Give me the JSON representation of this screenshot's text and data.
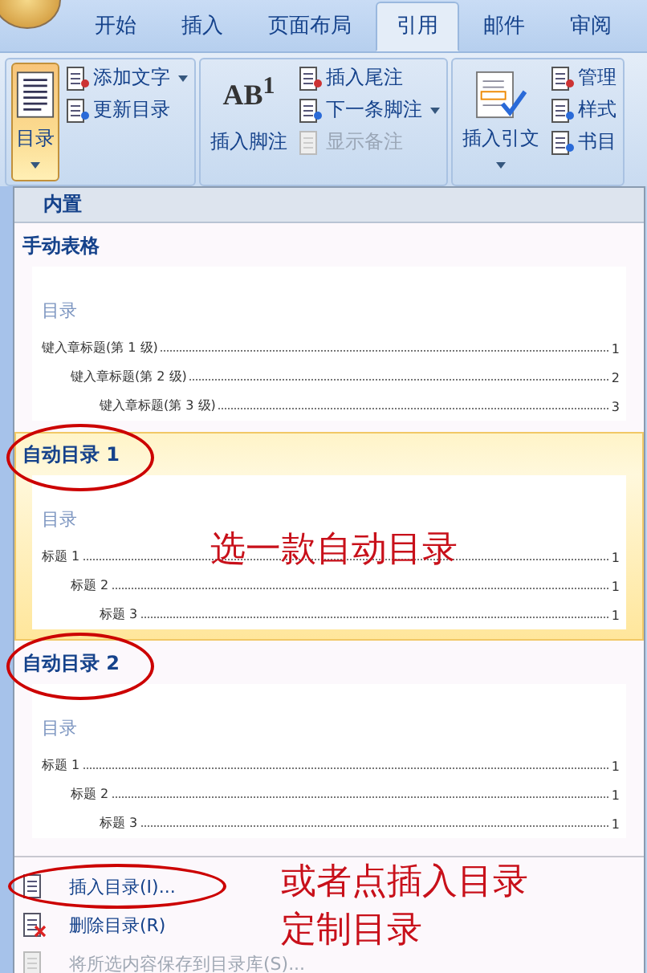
{
  "tabs": [
    {
      "label": "开始",
      "selected": false
    },
    {
      "label": "插入",
      "selected": false
    },
    {
      "label": "页面布局",
      "selected": false
    },
    {
      "label": "引用",
      "selected": true
    },
    {
      "label": "邮件",
      "selected": false
    },
    {
      "label": "审阅",
      "selected": false
    }
  ],
  "ribbon": {
    "groups": [
      {
        "big": {
          "label": "目录",
          "pressed": true,
          "dropdown": true
        },
        "small": [
          {
            "label": "添加文字",
            "dropdown": true,
            "disabled": false
          },
          {
            "label": "更新目录",
            "dropdown": false,
            "disabled": false
          }
        ]
      },
      {
        "big": {
          "label": "插入脚注",
          "icon_text": "AB$^{1}$",
          "pressed": false,
          "dropdown": false
        },
        "small": [
          {
            "label": "插入尾注",
            "dropdown": false,
            "disabled": false
          },
          {
            "label": "下一条脚注",
            "dropdown": true,
            "disabled": false
          },
          {
            "label": "显示备注",
            "dropdown": false,
            "disabled": true
          }
        ]
      },
      {
        "big": {
          "label": "插入引文",
          "pressed": false,
          "dropdown": true
        },
        "small": [
          {
            "label": "管理",
            "dropdown": false,
            "disabled": false
          },
          {
            "label": "样式",
            "dropdown": false,
            "disabled": false
          },
          {
            "label": "书目",
            "dropdown": false,
            "disabled": false
          }
        ]
      }
    ]
  },
  "menu": {
    "section_header": "内置",
    "gallery": [
      {
        "title": "手动表格",
        "selected": false,
        "preview_title": "目录",
        "entries": [
          {
            "text": "键入章标题(第 1 级)",
            "page": "1",
            "children": [
              {
                "text": "键入章标题(第 2 级)",
                "page": "2",
                "children": [
                  {
                    "text": "键入章标题(第 3 级)",
                    "page": "3"
                  }
                ]
              }
            ]
          }
        ]
      },
      {
        "title": "自动目录 1",
        "selected": true,
        "preview_title": "目录",
        "entries": [
          {
            "text": "标题 1",
            "page": "1",
            "children": [
              {
                "text": "标题 2",
                "page": "1",
                "children": [
                  {
                    "text": "标题 3",
                    "page": "1"
                  }
                ]
              }
            ]
          }
        ]
      },
      {
        "title": "自动目录 2",
        "selected": false,
        "preview_title": "目录",
        "entries": [
          {
            "text": "标题 1",
            "page": "1",
            "children": [
              {
                "text": "标题 2",
                "page": "1",
                "children": [
                  {
                    "text": "标题 3",
                    "page": "1"
                  }
                ]
              }
            ]
          }
        ]
      }
    ],
    "items": [
      {
        "label": "插入目录(I)...",
        "disabled": false
      },
      {
        "label": "删除目录(R)",
        "disabled": false
      },
      {
        "label": "将所选内容保存到目录库(S)...",
        "disabled": true
      }
    ]
  },
  "annotations": [
    {
      "lines": [
        "选一款自动目录"
      ]
    },
    {
      "lines": [
        "或者点插入目录",
        "定制目录"
      ]
    }
  ]
}
